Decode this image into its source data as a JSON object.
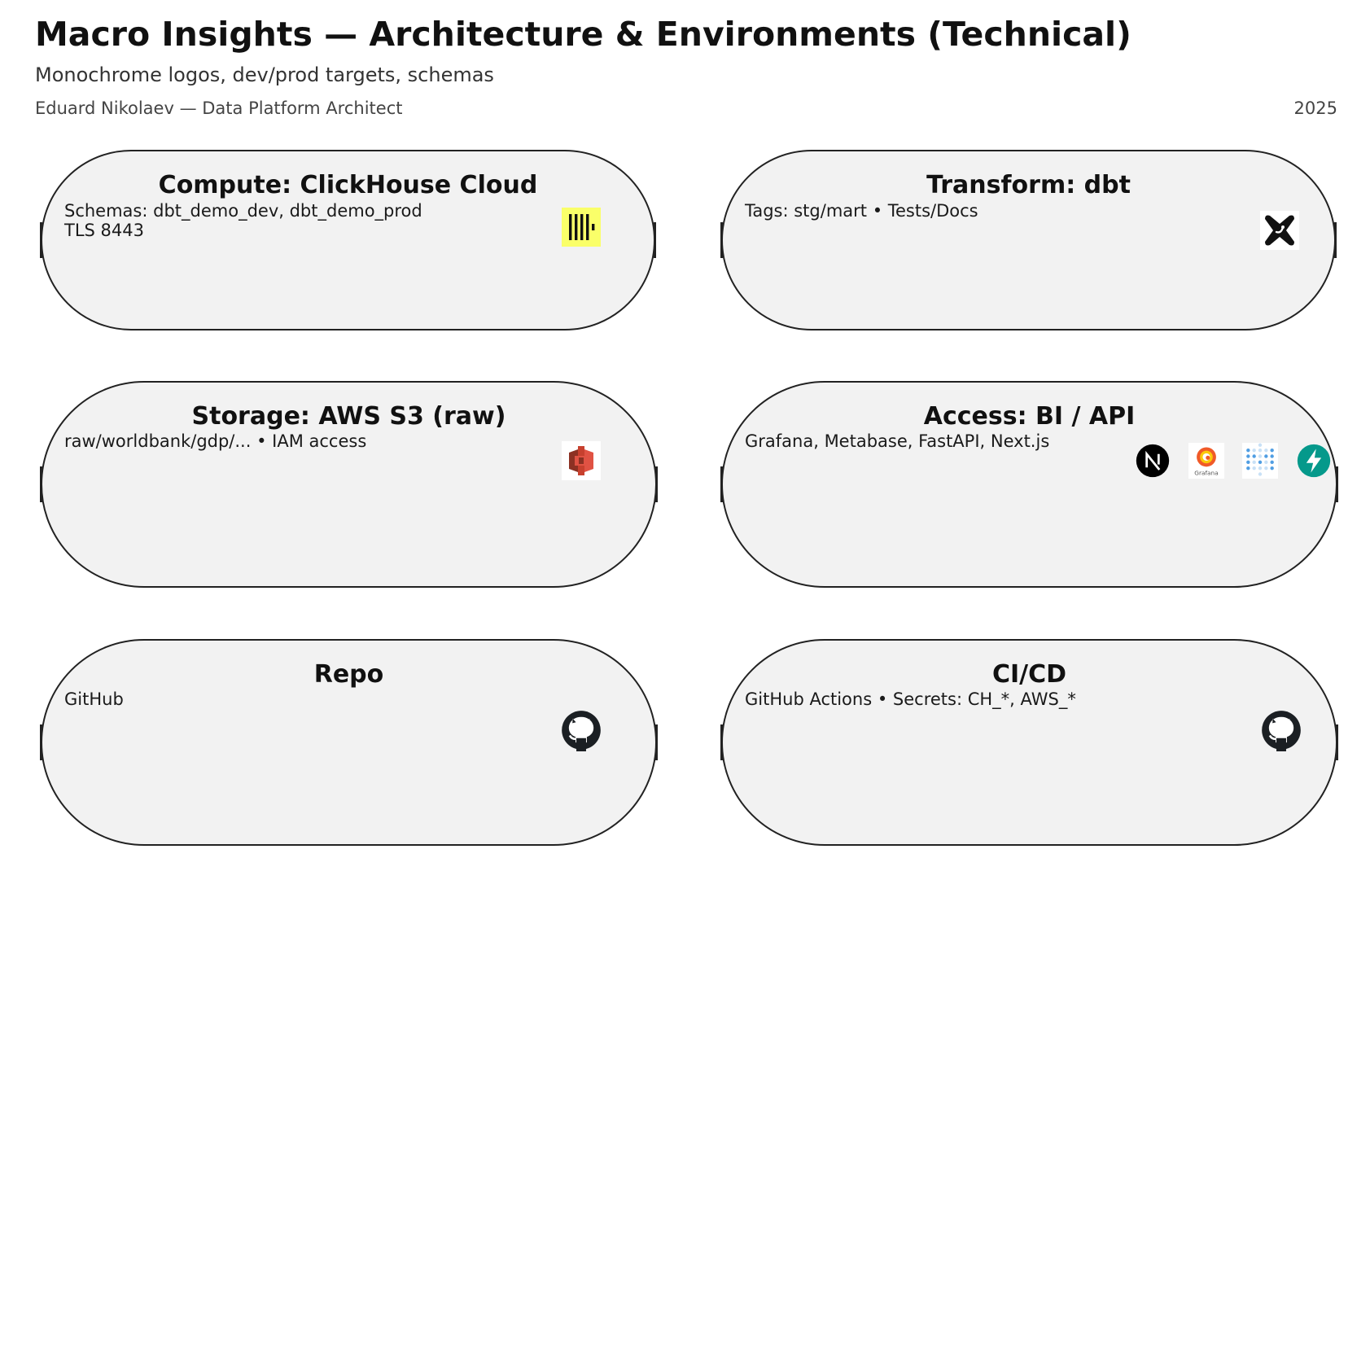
{
  "header": {
    "title": "Macro Insights — Architecture & Environments (Technical)",
    "subtitle": "Monochrome logos, dev/prod targets, schemas",
    "author": "Eduard Nikolaev — Data Platform Architect",
    "year": "2025"
  },
  "cards": [
    {
      "title": "Compute: ClickHouse Cloud",
      "lines": [
        "Schemas: dbt_demo_dev, dbt_demo_prod",
        "TLS 8443"
      ],
      "logos": [
        "clickhouse-icon"
      ]
    },
    {
      "title": "Transform: dbt",
      "lines": [
        "Tags: stg/mart • Tests/Docs"
      ],
      "logos": [
        "dbt-icon"
      ]
    },
    {
      "title": "Storage: AWS S3 (raw)",
      "lines": [
        "raw/worldbank/gdp/... • IAM access"
      ],
      "logos": [
        "aws-s3-icon"
      ]
    },
    {
      "title": "Access: BI / API",
      "lines": [
        "Grafana, Metabase, FastAPI, Next.js"
      ],
      "logos": [
        "nextjs-icon",
        "grafana-icon",
        "metabase-icon",
        "fastapi-icon"
      ],
      "logo_captions": {
        "grafana": "Grafana"
      }
    },
    {
      "title": "Repo",
      "lines": [
        "GitHub"
      ],
      "logos": [
        "github-icon"
      ]
    },
    {
      "title": "CI/CD",
      "lines": [
        "GitHub Actions • Secrets: CH_*, AWS_*"
      ],
      "logos": [
        "github-icon"
      ]
    }
  ],
  "colors": {
    "card_fill": "#f2f2f2",
    "card_border": "#222222",
    "clickhouse_bg": "#faff69",
    "aws_s3": "#e05243",
    "grafana": "#f05a28",
    "metabase": "#509ee3",
    "fastapi": "#009688",
    "github": "#1b1f23"
  }
}
